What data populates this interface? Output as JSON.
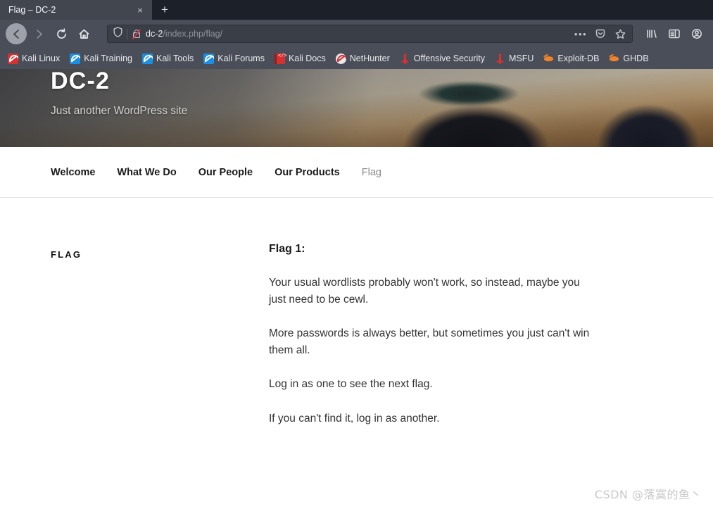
{
  "browser": {
    "tab": {
      "title": "Flag – DC-2",
      "close_label": "×",
      "new_tab_label": "+"
    },
    "nav": {
      "back_name": "back-button",
      "forward_name": "forward-button",
      "reload_name": "reload-button",
      "home_name": "home-button"
    },
    "url": {
      "host": "dc-2",
      "path": "/index.php/flag/",
      "page_actions_label": "•••",
      "shield_icon": "shield-icon",
      "insecure_lock_icon": "lock-crossed-out-icon",
      "pocket_icon": "pocket-icon",
      "bookmark_star_icon": "star-icon"
    },
    "toolbar": {
      "library_icon": "library-icon",
      "sidebar_icon": "sidebar-icon",
      "account_icon": "account-icon"
    },
    "bookmarks": [
      {
        "label": "Kali Linux",
        "icon": "kali-dragon-red-icon",
        "style": "kali red"
      },
      {
        "label": "Kali Training",
        "icon": "kali-dragon-blue-icon",
        "style": "kali blue"
      },
      {
        "label": "Kali Tools",
        "icon": "kali-dragon-blue-icon",
        "style": "kali blue"
      },
      {
        "label": "Kali Forums",
        "icon": "kali-dragon-blue-icon",
        "style": "kali blue"
      },
      {
        "label": "Kali Docs",
        "icon": "kali-docs-book-icon",
        "style": "book"
      },
      {
        "label": "NetHunter",
        "icon": "nethunter-icon",
        "style": "nh"
      },
      {
        "label": "Offensive Security",
        "icon": "offensive-security-icon",
        "style": "os"
      },
      {
        "label": "MSFU",
        "icon": "msfu-icon",
        "style": "os"
      },
      {
        "label": "Exploit-DB",
        "icon": "exploit-db-bug-icon",
        "style": "bug"
      },
      {
        "label": "GHDB",
        "icon": "ghdb-bug-icon",
        "style": "bug"
      }
    ]
  },
  "page": {
    "site_title": "DC-2",
    "site_tagline": "Just another WordPress site",
    "nav_items": [
      {
        "label": "Welcome",
        "current": false
      },
      {
        "label": "What We Do",
        "current": false
      },
      {
        "label": "Our People",
        "current": false
      },
      {
        "label": "Our Products",
        "current": false
      },
      {
        "label": "Flag",
        "current": true
      }
    ],
    "entry_label": "FLAG",
    "entry_title": "Flag 1:",
    "paragraphs": [
      "Your usual wordlists probably won't work, so instead, maybe you just need to be cewl.",
      "More passwords is always better, but sometimes you just can't win them all.",
      "Log in as one to see the next flag.",
      "If you can't find it, log in as another."
    ]
  },
  "watermark": "CSDN @落寞的鱼丶",
  "colors": {
    "chrome_toolbar": "#4a4e58",
    "tabstrip": "#1c2028",
    "active_tab": "#42464f",
    "urlbar": "#3a3e47",
    "page_background": "#ffffff",
    "nav_current": "#8a8a8a",
    "kali_red": "#d63031",
    "kali_blue": "#1a8fe3",
    "exploit_orange": "#f0832a"
  }
}
